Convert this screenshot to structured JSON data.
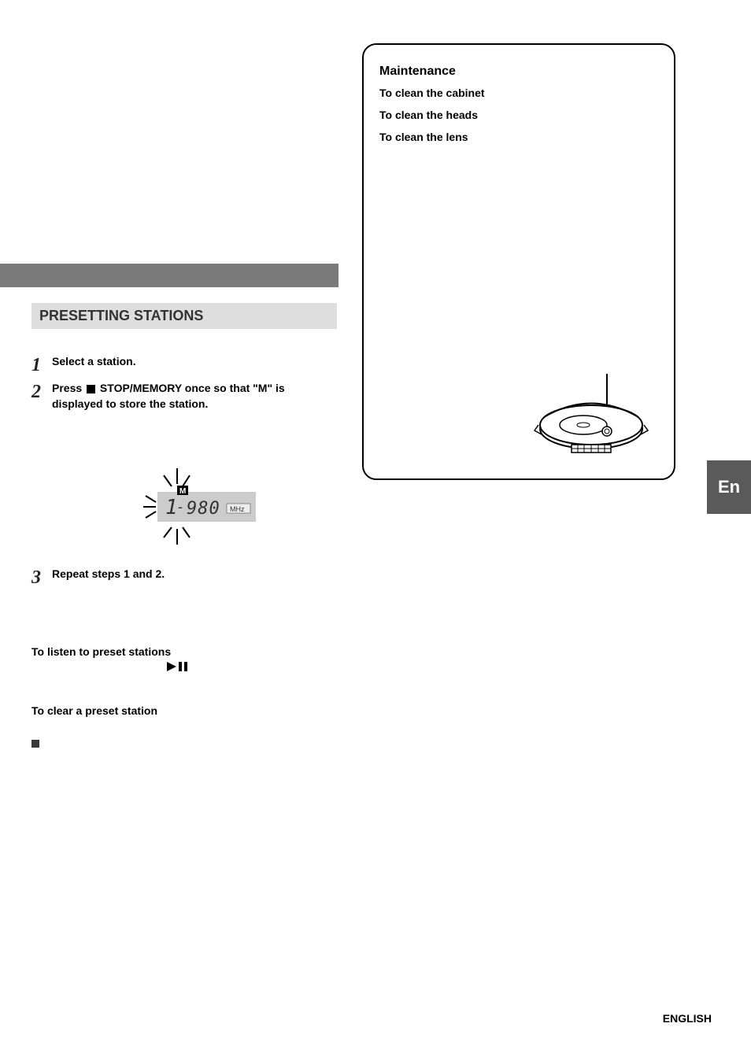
{
  "section_header": "PRESETTING STATIONS",
  "steps": [
    {
      "num": "1",
      "text": "Select a station."
    },
    {
      "num": "2",
      "text_before": "Press ",
      "text_mid": " STOP/MEMORY once so that \"M\" is displayed to store the station."
    }
  ],
  "display": {
    "preset_number": "1",
    "frequency": "980",
    "unit": "MHz",
    "indicator": "M"
  },
  "step3": {
    "num": "3",
    "text": "Repeat steps 1 and 2."
  },
  "listen_heading": "To listen to preset stations",
  "clear_heading": "To clear a preset station",
  "maintenance": {
    "title": "Maintenance",
    "cabinet": "To clean the cabinet",
    "heads": "To clean the heads",
    "lens": "To clean the lens"
  },
  "lang_tab": "En",
  "footer_lang": "ENGLISH"
}
